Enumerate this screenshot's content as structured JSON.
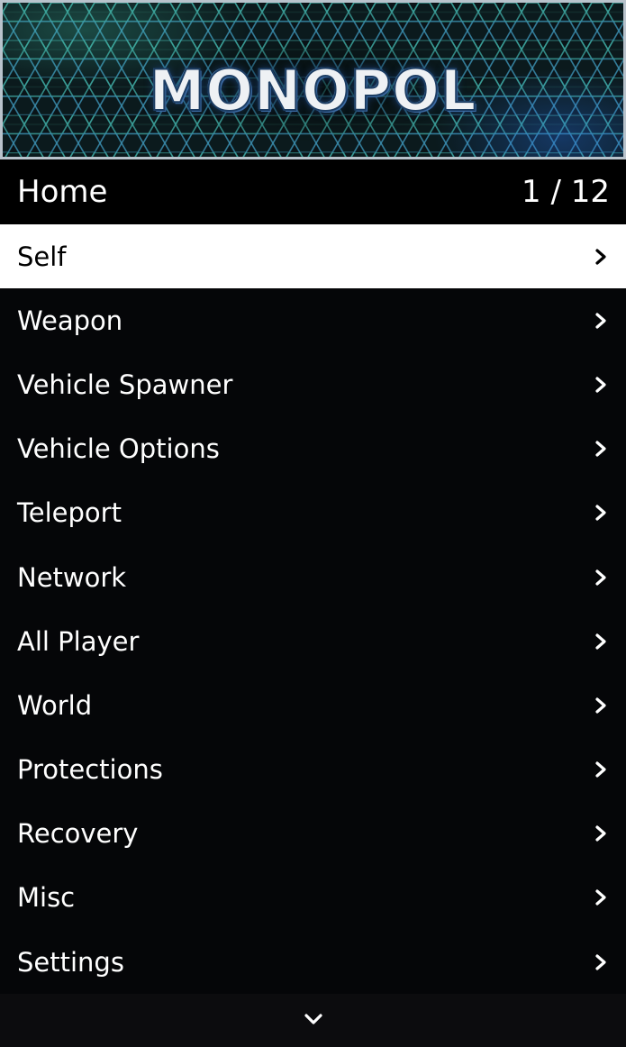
{
  "banner": {
    "logo_text": "MONOPOL"
  },
  "header": {
    "title": "Home",
    "counter": "1 / 12"
  },
  "menu_items": [
    {
      "label": "Self",
      "selected": true
    },
    {
      "label": "Weapon"
    },
    {
      "label": "Vehicle Spawner"
    },
    {
      "label": "Vehicle Options"
    },
    {
      "label": "Teleport"
    },
    {
      "label": "Network"
    },
    {
      "label": "All Player"
    },
    {
      "label": "World"
    },
    {
      "label": "Protections"
    },
    {
      "label": "Recovery"
    },
    {
      "label": "Misc"
    },
    {
      "label": "Settings"
    }
  ],
  "icons": {
    "item_arrow": "chevron-right-icon",
    "footer_arrow": "chevron-down-icon"
  },
  "colors": {
    "selected_background": "#ffffff",
    "selected_text": "#000000",
    "menu_text": "#ffffff",
    "menu_background": "#050608",
    "banner_border": "#b9c3cc"
  }
}
